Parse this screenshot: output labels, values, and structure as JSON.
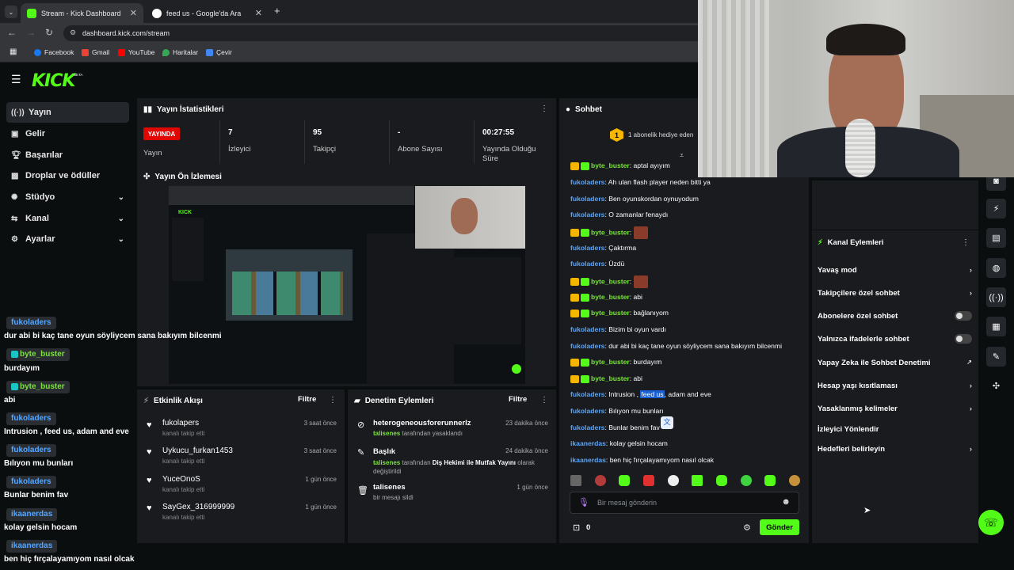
{
  "browser": {
    "tabs": [
      {
        "label": "Stream - Kick Dashboard",
        "active": true
      },
      {
        "label": "feed us - Google'da Ara",
        "active": false
      }
    ],
    "url": "dashboard.kick.com/stream",
    "bookmarks": [
      "Facebook",
      "Gmail",
      "YouTube",
      "Haritalar",
      "Çevir"
    ]
  },
  "brand": {
    "logo": "KICK",
    "beta": "BETA",
    "accent": "#53fc18"
  },
  "sidebar": {
    "items": [
      {
        "label": "Yayın",
        "icon": "broadcast-icon"
      },
      {
        "label": "Gelir",
        "icon": "wallet-icon"
      },
      {
        "label": "Başarılar",
        "icon": "trophy-icon"
      },
      {
        "label": "Droplar ve ödüller",
        "icon": "gift-icon"
      },
      {
        "label": "Stüdyo",
        "icon": "studio-icon"
      },
      {
        "label": "Kanal",
        "icon": "channel-icon"
      },
      {
        "label": "Ayarlar",
        "icon": "gear-icon"
      }
    ]
  },
  "stats": {
    "title": "Yayın İstatistikleri",
    "live_badge": "YAYINDA",
    "live_label": "Yayın",
    "viewers": {
      "value": "7",
      "label": "İzleyici"
    },
    "followers": {
      "value": "95",
      "label": "Takipçi"
    },
    "subs": {
      "value": "-",
      "label": "Abone Sayısı"
    },
    "uptime": {
      "value": "00:27:55",
      "label": "Yayında Olduğu Süre"
    }
  },
  "preview": {
    "title": "Yayın Ön İzlemesi"
  },
  "overlay_chat": [
    {
      "user": "fukoladers",
      "msg": "dur abi bi kaç tane oyun söyliycem sana bakıyım bilcenmi",
      "green": false
    },
    {
      "user": "byte_buster",
      "msg": "burdayım",
      "green": true
    },
    {
      "user": "byte_buster",
      "msg": "abi",
      "green": true
    },
    {
      "user": "fukoladers",
      "msg": "Intrusion , feed us, adam and eve",
      "green": false
    },
    {
      "user": "fukoladers",
      "msg": "Bılıyon mu bunları",
      "green": false
    },
    {
      "user": "fukoladers",
      "msg": "Bunlar benim fav",
      "green": false
    },
    {
      "user": "ikaanerdas",
      "msg": "kolay gelsin hocam",
      "green": false
    },
    {
      "user": "ikaanerdas",
      "msg": "ben hiç fırçalayamıyom nasıl olcak",
      "green": false
    }
  ],
  "activity": {
    "title": "Etkinlik Akışı",
    "filter": "Filtre",
    "items": [
      {
        "name": "fukolapers",
        "sub": "kanalı takip etti",
        "time": "3 saat önce"
      },
      {
        "name": "Uykucu_furkan1453",
        "sub": "kanalı takip etti",
        "time": "3 saat önce"
      },
      {
        "name": "YuceOnoS",
        "sub": "kanalı takip etti",
        "time": "1 gün önce"
      },
      {
        "name": "SayGex_316999999",
        "sub": "kanalı takip etti",
        "time": "1 gün önce"
      }
    ]
  },
  "moderation": {
    "title": "Denetim Eylemleri",
    "filter": "Filtre",
    "items": [
      {
        "title": "heterogeneousforerunnerlz",
        "actor": "talisenes",
        "desc": "tarafından yasaklandı",
        "time": "23 dakika önce"
      },
      {
        "title": "Başlık",
        "actor": "talisenes",
        "desc": "tarafından",
        "target": "Diş Hekimi ile Mutfak Yayını",
        "desc2": "olarak değiştirildi",
        "time": "24 dakika önce"
      },
      {
        "title": "talisenes",
        "desc": "bir mesajı sildi",
        "time": "1 gün önce"
      }
    ]
  },
  "chat": {
    "title": "Sohbet",
    "gift_banner": "1 abonelik hediye eden",
    "gift_count": "1",
    "messages": [
      {
        "user": "byte_buster",
        "text": "aptal ayıyım",
        "green": true
      },
      {
        "user": "fukoladers",
        "text": "Ah ulan flash player neden bitti ya",
        "green": false
      },
      {
        "user": "fukoladers",
        "text": "Ben oyunskordan oynuyodum",
        "green": false
      },
      {
        "user": "fukoladers",
        "text": "O zamanlar fenaydı",
        "green": false
      },
      {
        "user": "byte_buster",
        "text": "",
        "green": true,
        "emote": true
      },
      {
        "user": "fukoladers",
        "text": "Çaktırma",
        "green": false
      },
      {
        "user": "fukoladers",
        "text": "Üzdü",
        "green": false
      },
      {
        "user": "byte_buster",
        "text": "",
        "green": true,
        "emote": true
      },
      {
        "user": "byte_buster",
        "text": "abi",
        "green": true
      },
      {
        "user": "byte_buster",
        "text": "bağlanıyom",
        "green": true
      },
      {
        "user": "fukoladers",
        "text": "Bizim bi oyun vardı",
        "green": false
      },
      {
        "user": "fukoladers",
        "text": "dur abi bi kaç tane oyun söyliycem sana bakıyım bilcenmi",
        "green": false
      },
      {
        "user": "byte_buster",
        "text": "burdayım",
        "green": true
      },
      {
        "user": "byte_buster",
        "text": "abi",
        "green": true
      },
      {
        "user": "fukoladers",
        "text_pre": "Intrusion , ",
        "text_hl": "feed us",
        "text_post": ", adam and eve",
        "green": false
      },
      {
        "user": "fukoladers",
        "text": "Bılıyon mu bunları",
        "green": false
      },
      {
        "user": "fukoladers",
        "text": "Bunlar benim fav",
        "green": false
      },
      {
        "user": "ikaanerdas",
        "text": "kolay gelsin hocam",
        "green": false
      },
      {
        "user": "ikaanerdas",
        "text": "ben hiç fırçalayamıyom nasıl olcak",
        "green": false
      }
    ],
    "input_placeholder": "Bir mesaj gönderin",
    "points": "0",
    "send_label": "Gönder"
  },
  "channel_actions": {
    "title": "Kanal Eylemleri",
    "items": [
      {
        "label": "Yavaş mod",
        "kind": "arrow"
      },
      {
        "label": "Takipçilere özel sohbet",
        "kind": "arrow"
      },
      {
        "label": "Abonelere özel sohbet",
        "kind": "toggle"
      },
      {
        "label": "Yalnızca ifadelerle sohbet",
        "kind": "toggle"
      },
      {
        "label": "Yapay Zeka ile Sohbet Denetimi",
        "kind": "external"
      },
      {
        "label": "Hesap yaşı kısıtlaması",
        "kind": "arrow"
      },
      {
        "label": "Yasaklanmış kelimeler",
        "kind": "arrow"
      },
      {
        "label": "İzleyici Yönlendir",
        "kind": "none"
      },
      {
        "label": "Hedefleri belirleyin",
        "kind": "arrow"
      }
    ]
  }
}
